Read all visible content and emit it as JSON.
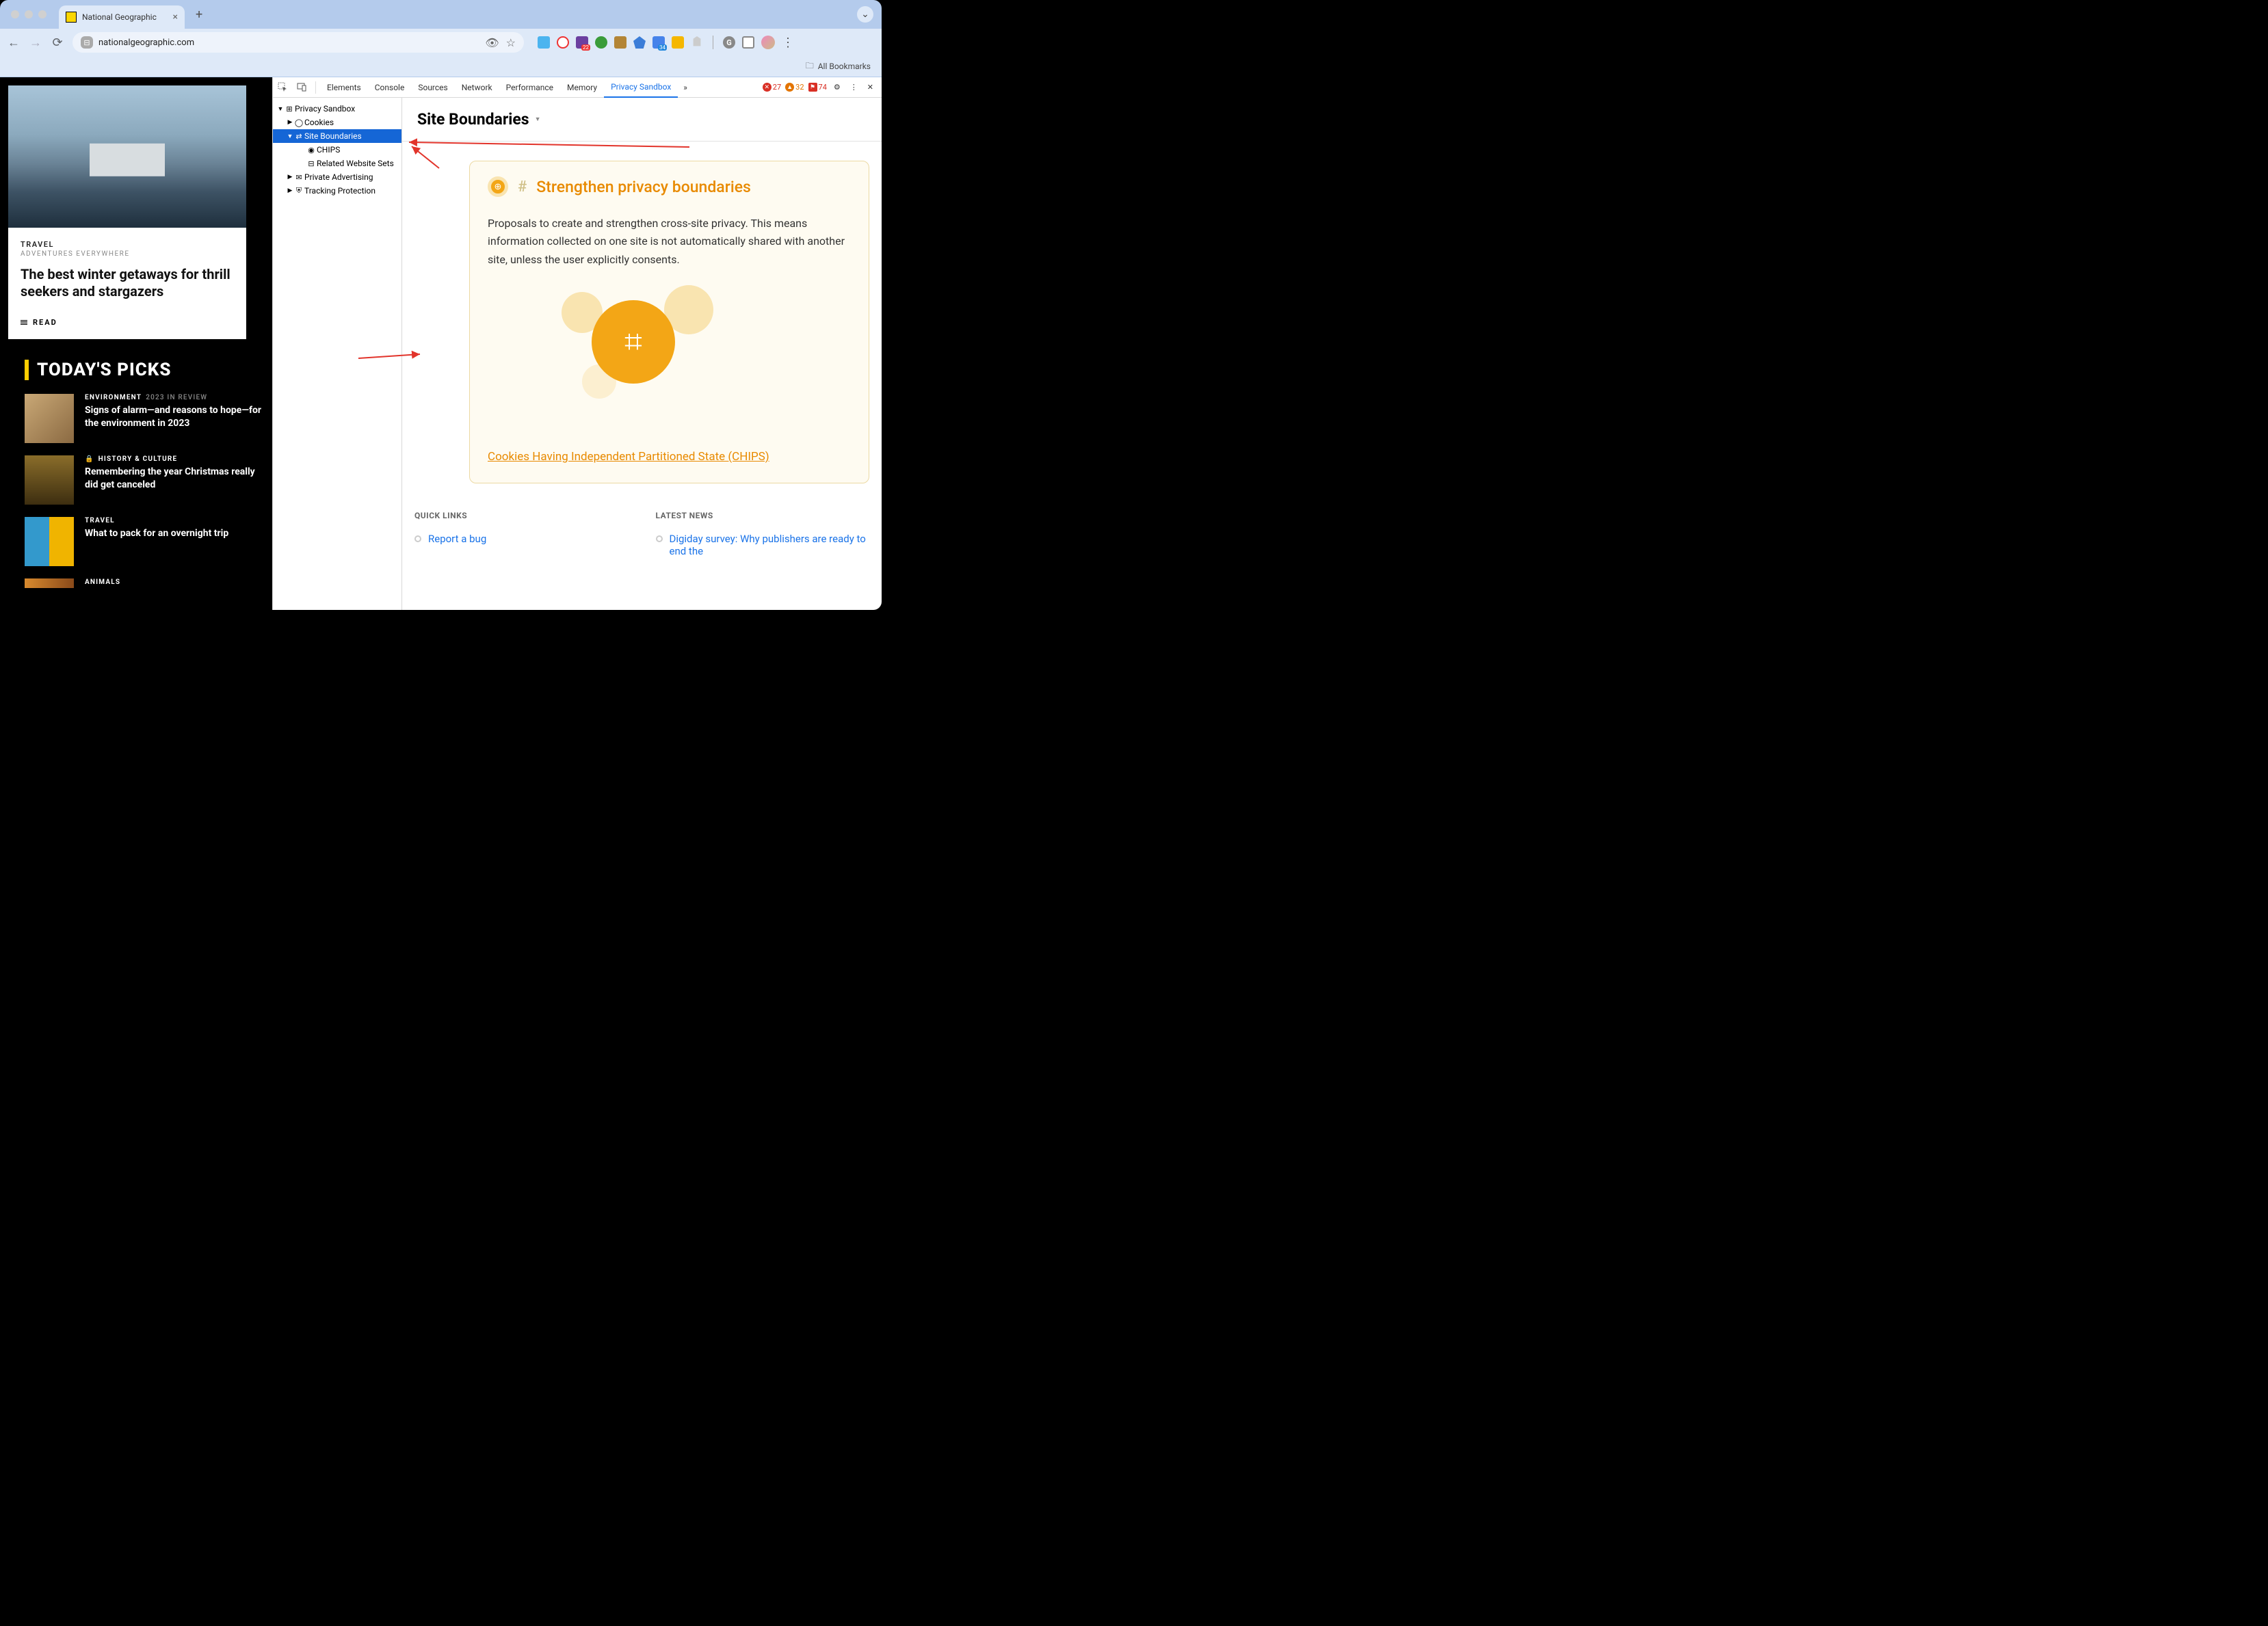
{
  "browser": {
    "tab_title": "National Geographic",
    "url": "nationalgeographic.com",
    "bookmarks_label": "All Bookmarks",
    "ext_badge_22": "22",
    "ext_badge_34": "34"
  },
  "page": {
    "hero": {
      "category": "TRAVEL",
      "subtitle": "ADVENTURES EVERYWHERE",
      "title": "The best winter getaways for thrill seekers and stargazers",
      "read": "READ"
    },
    "section_title": "TODAY'S PICKS",
    "picks": [
      {
        "category": "ENVIRONMENT",
        "year": "2023 IN REVIEW",
        "title": "Signs of alarm—and reasons to hope—for the environment in 2023",
        "locked": false
      },
      {
        "category": "HISTORY & CULTURE",
        "year": "",
        "title": "Remembering the year Christmas really did get canceled",
        "locked": true
      },
      {
        "category": "TRAVEL",
        "year": "",
        "title": "What to pack for an overnight trip",
        "locked": false
      },
      {
        "category": "ANIMALS",
        "year": "",
        "title": "",
        "locked": false
      }
    ]
  },
  "devtools": {
    "tabs": [
      "Elements",
      "Console",
      "Sources",
      "Network",
      "Performance",
      "Memory",
      "Privacy Sandbox"
    ],
    "active_tab": "Privacy Sandbox",
    "errors": "27",
    "warnings": "32",
    "info": "74",
    "tree": {
      "root": "Privacy Sandbox",
      "cookies": "Cookies",
      "site_boundaries": "Site Boundaries",
      "chips": "CHIPS",
      "related_sets": "Related Website Sets",
      "private_adv": "Private Advertising",
      "tracking": "Tracking Protection"
    },
    "content": {
      "heading": "Site Boundaries",
      "card_title": "Strengthen privacy boundaries",
      "card_desc": "Proposals to create and strengthen cross-site privacy. This means information collected on one site is not automatically shared with another site, unless the user explicitly consents.",
      "card_link": "Cookies Having Independent Partitioned State (CHIPS)",
      "quick_links_h": "QUICK LINKS",
      "quick_link_1": "Report a bug",
      "latest_news_h": "LATEST NEWS",
      "latest_news_1": "Digiday survey: Why publishers are ready to end the"
    }
  }
}
